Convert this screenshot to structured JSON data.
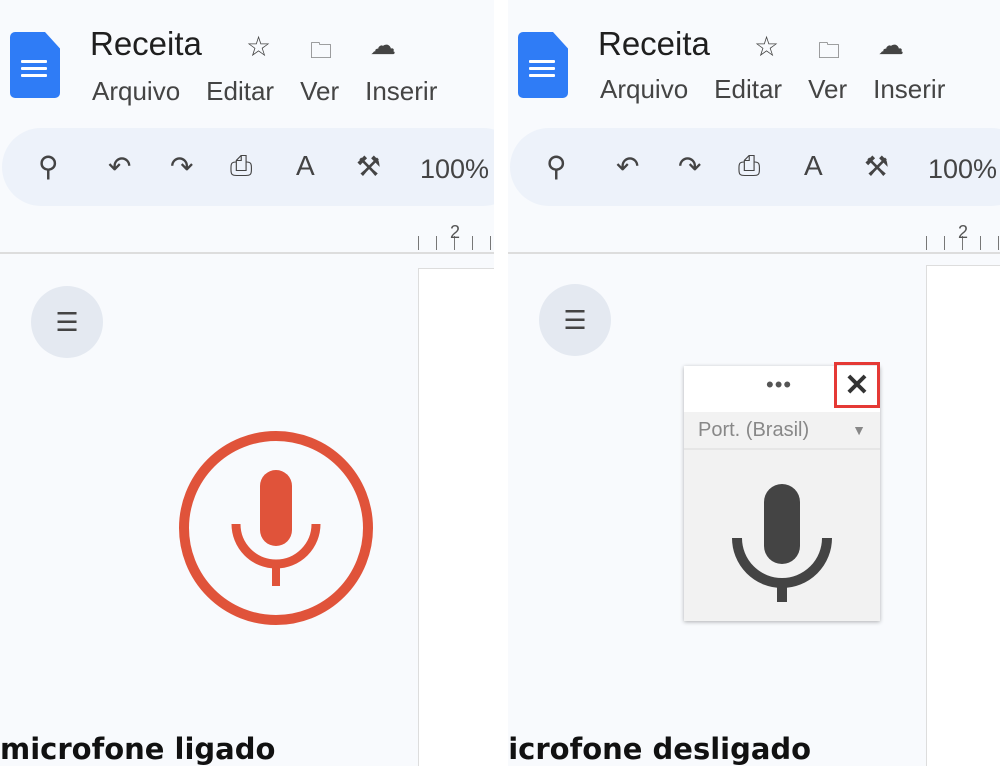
{
  "left": {
    "doc_title": "Receita",
    "menu": [
      "Arquivo",
      "Editar",
      "Ver",
      "Inserir"
    ],
    "zoom": "100%",
    "ruler_number": "2",
    "caption": "microfone ligado",
    "mic_color": "#e0533a"
  },
  "right": {
    "doc_title": "Receita",
    "menu": [
      "Arquivo",
      "Editar",
      "Ver",
      "Inserir"
    ],
    "zoom": "100%",
    "ruler_number": "2",
    "caption": "microfone desligado",
    "widget": {
      "more_label": "•••",
      "close_label": "✕",
      "language": "Port. (Brasil)"
    },
    "mic_color": "#444444",
    "highlight_color": "#e53935"
  }
}
